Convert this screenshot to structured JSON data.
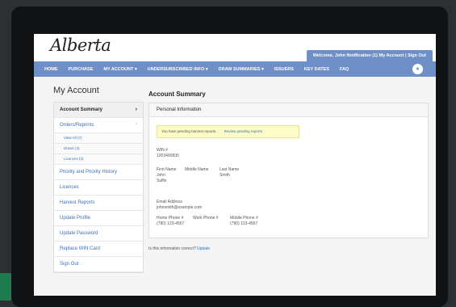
{
  "header": {
    "logo": "Alberta",
    "userbar": "Welcome, John  Notification (1) My Account | Sign Out"
  },
  "nav": {
    "items": [
      "HOME",
      "PURCHASE",
      "MY ACCOUNT ▾",
      "UNDERSUBSCRIBED INFO ▾",
      "DRAW SUMMARIES ▾",
      "ISSUERS",
      "KEY DATES",
      "FAQ"
    ]
  },
  "sidebar": {
    "title": "My Account",
    "items": [
      {
        "label": "Account Summary",
        "chevron": "›"
      },
      {
        "label": "Orders/Reprints",
        "chevron": "^"
      },
      {
        "label": "View All (7)"
      },
      {
        "label": "Draws (4)"
      },
      {
        "label": "Licences (3)"
      },
      {
        "label": "Priority and Priority History"
      },
      {
        "label": "Licences"
      },
      {
        "label": "Harvest Reports"
      },
      {
        "label": "Update Profile"
      },
      {
        "label": "Update Password"
      },
      {
        "label": "Replace WIN Card"
      },
      {
        "label": "Sign Out"
      }
    ]
  },
  "main": {
    "title": "Account Summary",
    "card_header": "Personal Information",
    "notice_text": "You have pending harvest reports.",
    "notice_link": "Review pending reports",
    "win_label": "WIN #",
    "win_value": "1203400835",
    "first_name_label": "First Name",
    "middle_name_label": "Middle Name",
    "last_name_label": "Last Name",
    "first_name": "John",
    "last_name": "Smith",
    "suffix_label": "Suffix",
    "email_label": "Email Address",
    "email_value": "johnsmith@example.com",
    "home_phone_label": "Home Phone #",
    "work_phone_label": "Work Phone #",
    "mobile_phone_label": "Mobile Phone #",
    "home_phone": "(780) 123-4567",
    "mobile_phone": "(780) 123-4567",
    "footer_question": "Is this information correct?",
    "footer_link": "Update"
  }
}
